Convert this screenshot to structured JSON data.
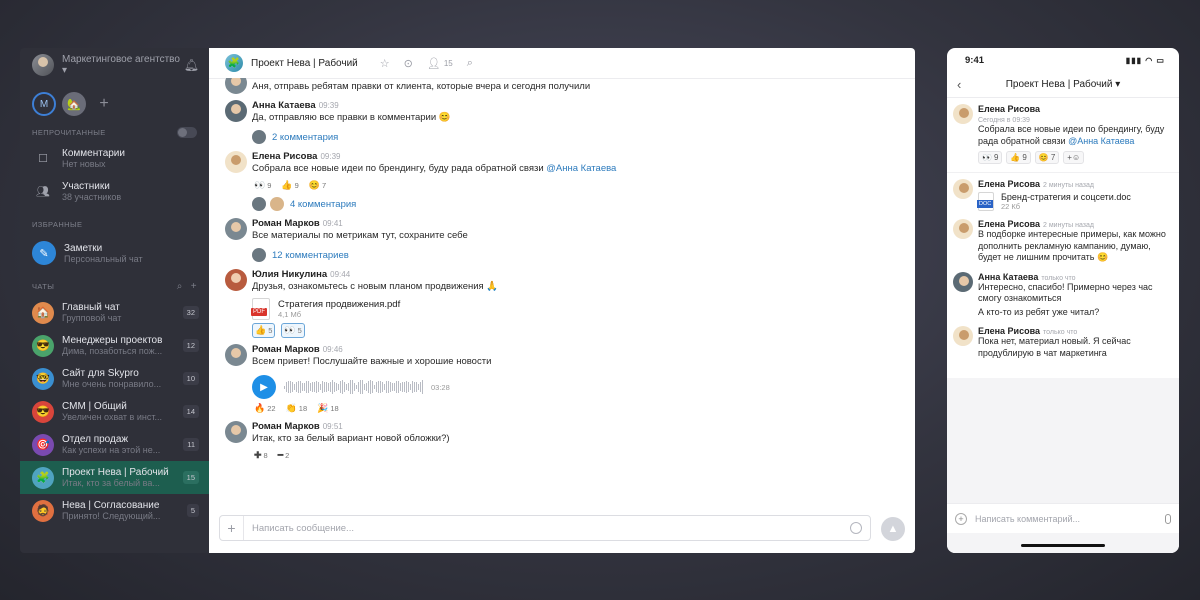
{
  "sidebar": {
    "workspace": "Маркетинговое агентство",
    "space_letter": "М",
    "section_unread": "НЕПРОЧИТАННЫЕ",
    "section_favorites": "ИЗБРАННЫЕ",
    "section_chats": "ЧАТЫ",
    "unread": [
      {
        "title": "Комментарии",
        "subtitle": "Нет новых"
      },
      {
        "title": "Участники",
        "subtitle": "38 участников"
      }
    ],
    "favorites": [
      {
        "title": "Заметки",
        "subtitle": "Персональный чат"
      }
    ],
    "chats": [
      {
        "title": "Главный чат",
        "subtitle": "Групповой чат",
        "count": "32",
        "color": "#e08a4d",
        "icon": "🏠"
      },
      {
        "title": "Менеджеры проектов",
        "subtitle": "Дима, позаботься пож...",
        "count": "12",
        "color": "#4aa36b",
        "icon": "😎"
      },
      {
        "title": "Сайт для Skypro",
        "subtitle": "Мне очень понравило...",
        "count": "10",
        "color": "#3a8fd1",
        "icon": "🤓"
      },
      {
        "title": "СММ | Общий",
        "subtitle": "Увеличен охват в инст...",
        "count": "14",
        "color": "#d9453b",
        "icon": "😎"
      },
      {
        "title": "Отдел продаж",
        "subtitle": "Как успехи на этой не...",
        "count": "11",
        "color": "#7a4ab0",
        "icon": "🎯"
      },
      {
        "title": "Проект Нева | Рабочий",
        "subtitle": "Итак, кто за белый ва...",
        "count": "15",
        "color": "#4fa3c0",
        "icon": "🧩"
      },
      {
        "title": "Нева | Согласование",
        "subtitle": "Принято! Следующий...",
        "count": "5",
        "color": "#e07040",
        "icon": "🧔"
      }
    ]
  },
  "main": {
    "title": "Проект Нева | Рабочий",
    "members": "15",
    "composer_placeholder": "Написать сообщение...",
    "first_text": "Аня, отправь ребятам правки от клиента, которые вчера и сегодня получили",
    "m1": {
      "author": "Анна Катаева",
      "time": "09:39",
      "text": "Да, отправляю все правки в комментарии 😊",
      "thread": "2 комментария"
    },
    "m2": {
      "author": "Елена Рисова",
      "time": "09:39",
      "text_before": "Собрала все новые идеи по брендингу, буду рада обратной связи ",
      "mention": "@Анна Катаева",
      "thread": "4 комментария",
      "reactions": [
        {
          "e": "👀",
          "c": "9"
        },
        {
          "e": "👍",
          "c": "9"
        },
        {
          "e": "😊",
          "c": "7"
        }
      ]
    },
    "m3": {
      "author": "Роман Марков",
      "time": "09:41",
      "text": "Все материалы по метрикам тут, сохраните себе",
      "thread": "12 комментариев"
    },
    "m4": {
      "author": "Юлия Никулина",
      "time": "09:44",
      "text": "Друзья, ознакомьтесь с новым планом продвижения 🙏",
      "file": "Стратегия продвижения.pdf",
      "size": "4,1 Мб",
      "reactions": [
        {
          "e": "👍",
          "c": "5"
        },
        {
          "e": "👀",
          "c": "5"
        }
      ]
    },
    "m5": {
      "author": "Роман Марков",
      "time": "09:46",
      "text": "Всем привет! Послушайте важные и хорошие новости",
      "duration": "03:28",
      "reactions": [
        {
          "e": "🔥",
          "c": "22"
        },
        {
          "e": "👏",
          "c": "18"
        },
        {
          "e": "🎉",
          "c": "18"
        }
      ]
    },
    "m6": {
      "author": "Роман Марков",
      "time": "09:51",
      "text": "Итак, кто за белый вариант новой обложки?)",
      "plus": "8",
      "minus": "2"
    }
  },
  "phone": {
    "time": "9:41",
    "title": "Проект Нева | Рабочий",
    "root": {
      "author": "Елена Рисова",
      "time": "Сегодня в 09:39",
      "text_before": "Собрала все новые идеи по брендингу, буду рада обратной связи ",
      "mention": "@Анна Катаева",
      "reactions": [
        {
          "e": "👀",
          "c": "9"
        },
        {
          "e": "👍",
          "c": "9"
        },
        {
          "e": "😊",
          "c": "7"
        }
      ]
    },
    "c1": {
      "author": "Елена Рисова",
      "time": "2 минуты назад",
      "file": "Бренд-стратегия и соцсети.doc",
      "size": "22 Кб"
    },
    "c2": {
      "author": "Елена Рисова",
      "time": "2 минуты назад",
      "text": "В подборке интересные примеры, как можно дополнить рекламную кампанию, думаю, будет не лишним прочитать 😊"
    },
    "c3": {
      "author": "Анна Катаева",
      "time": "только что",
      "text": "Интересно, спасибо! Примерно через час смогу ознакомиться",
      "text2": "А кто-то из ребят уже читал?"
    },
    "c4": {
      "author": "Елена Рисова",
      "time": "только что",
      "text": "Пока нет, материал новый. Я сейчас продублирую в чат маркетинга"
    },
    "input_placeholder": "Написать комментарий..."
  }
}
